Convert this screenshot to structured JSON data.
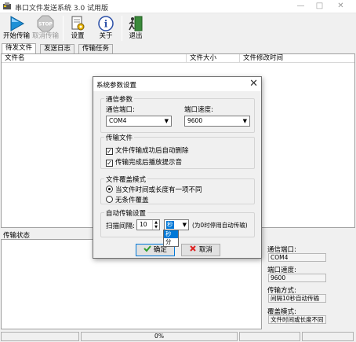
{
  "window": {
    "title": "串口文件发送系统 3.0 试用版",
    "controls": {
      "minimize": "—",
      "maximize": "□",
      "close": "✕"
    }
  },
  "toolbar": {
    "start_send": "开始传输",
    "cancel_send": "取消传输",
    "settings": "设置",
    "about": "关于",
    "exit": "退出"
  },
  "tabs": [
    "待发文件",
    "发送日志",
    "传输任务"
  ],
  "file_list": {
    "columns": [
      "文件名",
      "文件大小",
      "文件修改时间"
    ]
  },
  "transfer_status_label": "传输状态",
  "side_panel": {
    "port_label": "通信端口:",
    "port_value": "COM4",
    "speed_label": "端口速度:",
    "speed_value": "9600",
    "mode_label": "传输方式:",
    "mode_value": "间隔10秒自动传输",
    "overwrite_label": "覆盖模式:",
    "overwrite_value": "文件时间或长度不同"
  },
  "statusbar": {
    "progress": "0%"
  },
  "dialog": {
    "title": "系统参数设置",
    "close": "✕",
    "comm_group": {
      "title": "通信参数",
      "port_label": "通信端口:",
      "port_value": "COM4",
      "speed_label": "端口速度:",
      "speed_value": "9600"
    },
    "transfer_group": {
      "title": "传输文件",
      "delete_after_success": "文件传输成功后自动删除",
      "play_sound": "传输完成后播放提示音",
      "delete_checked": true,
      "sound_checked": true
    },
    "overwrite_group": {
      "title": "文件覆盖模式",
      "option_different": "当文件时间或长度有一项不同",
      "option_unconditional": "无条件覆盖",
      "selected": "option_different"
    },
    "auto_group": {
      "title": "自动传输设置",
      "interval_label": "扫描间隔:",
      "interval_value": "10",
      "unit_value": "秒",
      "unit_options": [
        "秒",
        "分"
      ],
      "hint": "(为0时停用自动传输)"
    },
    "ok_button": "确定",
    "cancel_button": "取消"
  },
  "colors": {
    "selection": "#0078d7",
    "ok_icon": "#2e9e2e",
    "cancel_icon": "#d22",
    "play_icon": "#1e90d6"
  }
}
